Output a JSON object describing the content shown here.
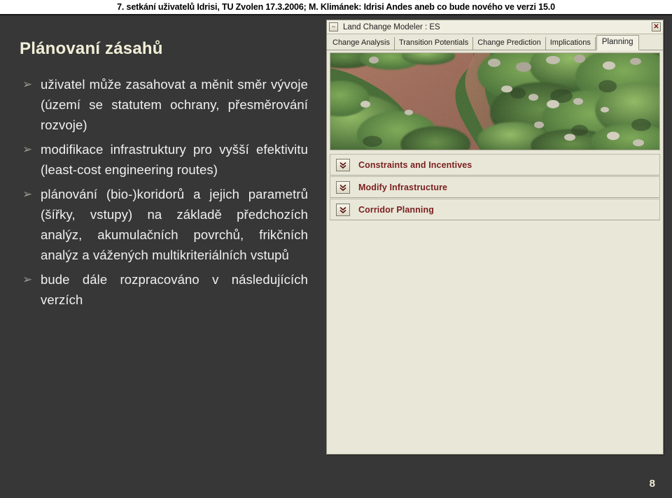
{
  "header": {
    "title": "7. setkání uživatelů Idrisi, TU Zvolen 17.3.2006; M. Klimánek: Idrisi Andes aneb co bude nového ve verzi 15.0"
  },
  "slide": {
    "title": "Plánovaní zásahů",
    "page_number": "8",
    "bullet_marker": "➢",
    "bullets": [
      "uživatel může zasahovat a měnit směr vývoje (území se statutem ochrany, přesměrování rozvoje)",
      "modifikace infrastruktury pro vyšší efektivitu (least-cost engineering routes)",
      "plánování (bio-)koridorů a jejich parametrů (šířky, vstupy) na základě předchozích analýz, akumulačních povrchů, frikčních analýz a vážených multikriteriálních vstupů",
      "bude dále rozpracováno v následujících verzích"
    ]
  },
  "lcm_window": {
    "title": "Land Change Modeler : ES",
    "minimize_label": "−",
    "close_label": "✕",
    "tabs": [
      {
        "label": "Change Analysis",
        "active": false
      },
      {
        "label": "Transition Potentials",
        "active": false
      },
      {
        "label": "Change Prediction",
        "active": false
      },
      {
        "label": "Implications",
        "active": false
      },
      {
        "label": "Planning",
        "active": true
      }
    ],
    "image_caption": "aerial photograph of a brown river winding through dense green rainforest canopy",
    "panels": [
      {
        "label": "Constraints and Incentives"
      },
      {
        "label": "Modify Infrastructure"
      },
      {
        "label": "Corridor Planning"
      }
    ]
  },
  "colors": {
    "slide_background": "#373737",
    "slide_title": "#f2efd8",
    "bullet_text": "#f0f0f0",
    "window_background": "#e9e7d8",
    "panel_label": "#7a1f1f",
    "river": "#9e6a55",
    "canopy": "#4e7b36"
  }
}
